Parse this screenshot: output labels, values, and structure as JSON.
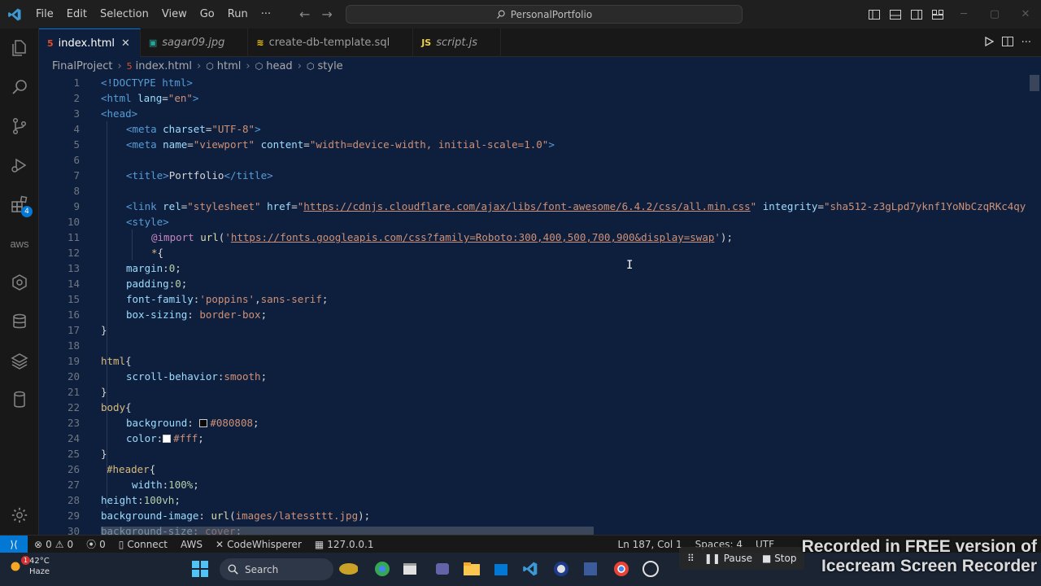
{
  "titlebar": {
    "menu": [
      "File",
      "Edit",
      "Selection",
      "View",
      "Go",
      "Run",
      "···"
    ],
    "search_text": "PersonalPortfolio"
  },
  "activitybar": {
    "icons": [
      "files-icon",
      "search-icon",
      "source-control-icon",
      "run-debug-icon",
      "extensions-icon",
      "aws-icon",
      "aws-explorer-icon",
      "database-icon",
      "stack-icon",
      "cylinder-icon"
    ],
    "extensions_badge": "4",
    "aws_label": "aws"
  },
  "tabs": [
    {
      "label": "index.html",
      "icon": "html-icon",
      "active": true
    },
    {
      "label": "sagar09.jpg",
      "icon": "image-icon",
      "active": false
    },
    {
      "label": "create-db-template.sql",
      "icon": "database-icon",
      "active": false
    },
    {
      "label": "script.js",
      "icon": "js-icon",
      "active": false
    }
  ],
  "breadcrumbs": [
    "FinalProject",
    "index.html",
    "html",
    "head",
    "style"
  ],
  "editor": {
    "lines": [
      {
        "n": "1",
        "segs": [
          [
            "tag",
            "<!DOCTYPE html>"
          ]
        ]
      },
      {
        "n": "2",
        "segs": [
          [
            "tag",
            "<html "
          ],
          [
            "attr",
            "lang"
          ],
          [
            "txt",
            "="
          ],
          [
            "str",
            "\"en\""
          ],
          [
            "tag",
            ">"
          ]
        ]
      },
      {
        "n": "3",
        "segs": [
          [
            "tag",
            "<head>"
          ]
        ]
      },
      {
        "n": "4",
        "indent": 1,
        "segs": [
          [
            "tag",
            "<meta "
          ],
          [
            "attr",
            "charset"
          ],
          [
            "txt",
            "="
          ],
          [
            "str",
            "\"UTF-8\""
          ],
          [
            "tag",
            ">"
          ]
        ]
      },
      {
        "n": "5",
        "indent": 1,
        "segs": [
          [
            "tag",
            "<meta "
          ],
          [
            "attr",
            "name"
          ],
          [
            "txt",
            "="
          ],
          [
            "str",
            "\"viewport\""
          ],
          [
            "attr",
            " content"
          ],
          [
            "txt",
            "="
          ],
          [
            "str",
            "\"width=device-width, initial-scale=1.0\""
          ],
          [
            "tag",
            ">"
          ]
        ]
      },
      {
        "n": "6",
        "segs": []
      },
      {
        "n": "7",
        "indent": 1,
        "segs": [
          [
            "tag",
            "<title>"
          ],
          [
            "txt",
            "Portfolio"
          ],
          [
            "tag",
            "</title>"
          ]
        ]
      },
      {
        "n": "8",
        "segs": []
      },
      {
        "n": "9",
        "indent": 1,
        "segs": [
          [
            "tag",
            "<link "
          ],
          [
            "attr",
            "rel"
          ],
          [
            "txt",
            "="
          ],
          [
            "str",
            "\"stylesheet\""
          ],
          [
            "attr",
            " href"
          ],
          [
            "txt",
            "="
          ],
          [
            "str",
            "\""
          ],
          [
            "link",
            "https://cdnjs.cloudflare.com/ajax/libs/font-awesome/6.4.2/css/all.min.css"
          ],
          [
            "str",
            "\""
          ],
          [
            "attr",
            " integrity"
          ],
          [
            "txt",
            "="
          ],
          [
            "str",
            "\"sha512-z3gLpd7yknf1YoNbCzqRKc4qy"
          ]
        ]
      },
      {
        "n": "10",
        "indent": 1,
        "segs": [
          [
            "tag",
            "<style>"
          ]
        ]
      },
      {
        "n": "11",
        "indent": 2,
        "segs": [
          [
            "at",
            "@import "
          ],
          [
            "fn",
            "url"
          ],
          [
            "txt",
            "("
          ],
          [
            "str",
            "'"
          ],
          [
            "link",
            "https://fonts.googleapis.com/css?family=Roboto:300,400,500,700,900&display=swap"
          ],
          [
            "str",
            "'"
          ],
          [
            "txt",
            ");"
          ]
        ]
      },
      {
        "n": "12",
        "indent": 2,
        "segs": [
          [
            "sel",
            "*"
          ],
          [
            "txt",
            "{"
          ]
        ]
      },
      {
        "n": "13",
        "indent": 1,
        "segs": [
          [
            "prop",
            "margin"
          ],
          [
            "txt",
            ":"
          ],
          [
            "num",
            "0"
          ],
          [
            "txt",
            ";"
          ]
        ]
      },
      {
        "n": "14",
        "indent": 1,
        "segs": [
          [
            "prop",
            "padding"
          ],
          [
            "txt",
            ":"
          ],
          [
            "num",
            "0"
          ],
          [
            "txt",
            ";"
          ]
        ]
      },
      {
        "n": "15",
        "indent": 1,
        "segs": [
          [
            "prop",
            "font-family"
          ],
          [
            "txt",
            ":"
          ],
          [
            "val",
            "'poppins'"
          ],
          [
            "txt",
            ","
          ],
          [
            "val",
            "sans-serif"
          ],
          [
            "txt",
            ";"
          ]
        ]
      },
      {
        "n": "16",
        "indent": 1,
        "segs": [
          [
            "prop",
            "box-sizing"
          ],
          [
            "txt",
            ": "
          ],
          [
            "val",
            "border-box"
          ],
          [
            "txt",
            ";"
          ]
        ]
      },
      {
        "n": "17",
        "segs": [
          [
            "txt",
            "}"
          ]
        ]
      },
      {
        "n": "18",
        "segs": []
      },
      {
        "n": "19",
        "segs": [
          [
            "sel",
            "html"
          ],
          [
            "txt",
            "{"
          ]
        ]
      },
      {
        "n": "20",
        "indent": 1,
        "segs": [
          [
            "prop",
            "scroll-behavior"
          ],
          [
            "txt",
            ":"
          ],
          [
            "val",
            "smooth"
          ],
          [
            "txt",
            ";"
          ]
        ]
      },
      {
        "n": "21",
        "segs": [
          [
            "txt",
            "}"
          ]
        ]
      },
      {
        "n": "22",
        "segs": [
          [
            "sel",
            "body"
          ],
          [
            "txt",
            "{"
          ]
        ]
      },
      {
        "n": "23",
        "indent": 1,
        "segs": [
          [
            "prop",
            "background"
          ],
          [
            "txt",
            ": "
          ],
          [
            "swatch",
            "#080808"
          ],
          [
            "val",
            "#080808"
          ],
          [
            "txt",
            ";"
          ]
        ]
      },
      {
        "n": "24",
        "indent": 1,
        "segs": [
          [
            "prop",
            "color"
          ],
          [
            "txt",
            ":"
          ],
          [
            "swatch",
            "#ffffff"
          ],
          [
            "val",
            "#fff"
          ],
          [
            "txt",
            ";"
          ]
        ]
      },
      {
        "n": "25",
        "segs": [
          [
            "txt",
            "}"
          ]
        ]
      },
      {
        "n": "26",
        "indent": 3,
        "segs": [
          [
            "sel",
            "#header"
          ],
          [
            "txt",
            "{"
          ]
        ]
      },
      {
        "n": "27",
        "indent": 4,
        "segs": [
          [
            "prop",
            "width"
          ],
          [
            "txt",
            ":"
          ],
          [
            "num",
            "100%"
          ],
          [
            "txt",
            ";"
          ]
        ]
      },
      {
        "n": "28",
        "segs": [
          [
            "prop",
            "height"
          ],
          [
            "txt",
            ":"
          ],
          [
            "num",
            "100vh"
          ],
          [
            "txt",
            ";"
          ]
        ]
      },
      {
        "n": "29",
        "segs": [
          [
            "prop",
            "background-image"
          ],
          [
            "txt",
            ": "
          ],
          [
            "fn",
            "url"
          ],
          [
            "txt",
            "("
          ],
          [
            "val",
            "images/latessttt.jpg"
          ],
          [
            "txt",
            ");"
          ]
        ]
      },
      {
        "n": "30",
        "segs": [
          [
            "prop",
            "background-size"
          ],
          [
            "txt",
            ": "
          ],
          [
            "val",
            "cover"
          ],
          [
            "txt",
            ";"
          ]
        ]
      }
    ]
  },
  "statusbar": {
    "errors": "0",
    "warnings": "0",
    "ports": "0",
    "connect": "Connect",
    "aws": "AWS",
    "codewhisperer": "CodeWhisperer",
    "liveserver": "127.0.0.1",
    "position": "Ln 187, Col 1",
    "spaces": "Spaces: 4",
    "encoding": "UTF"
  },
  "taskbar": {
    "temperature": "42°C",
    "condition": "Haze",
    "weather_badge": "1",
    "search_label": "Search"
  },
  "recorder": {
    "pause_label": "Pause",
    "stop_label": "Stop",
    "watermark_line1": "Recorded in FREE version of",
    "watermark_line2": "Icecream Screen Recorder"
  },
  "colors": {
    "editor_bg": "#0e1f3d",
    "accent": "#0078d4",
    "tag": "#569cd6",
    "string": "#ce9178"
  }
}
